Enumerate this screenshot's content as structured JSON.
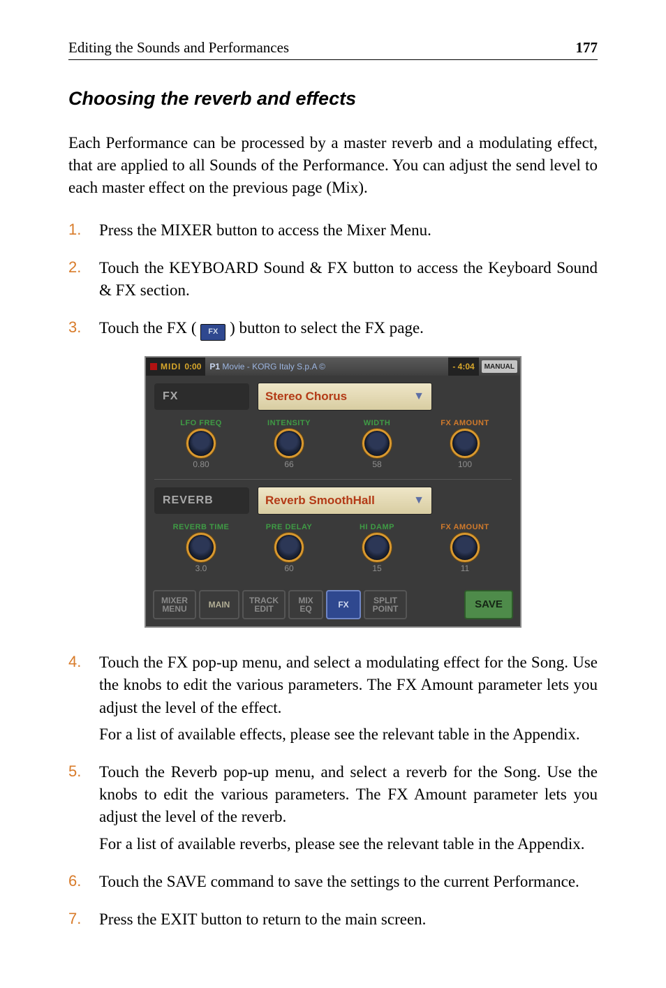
{
  "header": {
    "left": "Editing the Sounds and Performances",
    "page": "177"
  },
  "section": {
    "title": "Choosing the reverb and effects"
  },
  "intro": "Each Performance can be processed by a master reverb and a modulating effect, that are applied to all Sounds of the Performance. You can adjust the send level to each master effect on the previous page (Mix).",
  "steps": {
    "s1": "Press the MIXER button to access the Mixer Menu.",
    "s2": "Touch the KEYBOARD Sound & FX button to access the Keyboard Sound & FX section.",
    "s3_a": "Touch the FX (",
    "s3_b": ") button to select the FX page.",
    "s4_a": "Touch the FX pop-up menu, and select a modulating effect for the Song. Use the knobs to edit the various parameters. The FX Amount parameter lets you adjust the level of the effect.",
    "s4_b": "For a list of available effects, please see the relevant table in the Appendix.",
    "s5_a": "Touch the Reverb pop-up menu, and select a reverb for the Song. Use the knobs to edit the various parameters. The FX Amount parameter lets you adjust the level of the reverb.",
    "s5_b": "For a list of available reverbs, please see the relevant table in the Appendix.",
    "s6": "Touch the SAVE command to save the settings to the current Performance.",
    "s7": "Press the EXIT button to return to the main screen."
  },
  "inline_fx": "FX",
  "shot": {
    "titlebar": {
      "midi": "MIDI",
      "time_l": "0:00",
      "perf_prefix": "P1",
      "perf_name": "Movie - KORG Italy S.p.A ©",
      "time_r": "- 4:04",
      "manual": "MANUAL"
    },
    "fx": {
      "label": "FX",
      "selected": "Stereo Chorus",
      "params": [
        {
          "label": "LFO FREQ",
          "value": "0.80"
        },
        {
          "label": "INTENSITY",
          "value": "66"
        },
        {
          "label": "WIDTH",
          "value": "58"
        },
        {
          "label": "FX AMOUNT",
          "value": "100",
          "accent": "orange"
        }
      ]
    },
    "reverb": {
      "label": "REVERB",
      "selected": "Reverb SmoothHall",
      "params": [
        {
          "label": "REVERB TIME",
          "value": "3.0"
        },
        {
          "label": "PRE DELAY",
          "value": "60"
        },
        {
          "label": "HI DAMP",
          "value": "15"
        },
        {
          "label": "FX AMOUNT",
          "value": "11",
          "accent": "orange"
        }
      ]
    },
    "tabs": {
      "mixer_menu": "MIXER\nMENU",
      "main": "MAIN",
      "track_edit": "TRACK\nEDIT",
      "mix_eq": "MIX\nEQ",
      "fx": "FX",
      "split_point": "SPLIT\nPOINT",
      "save": "SAVE"
    }
  }
}
